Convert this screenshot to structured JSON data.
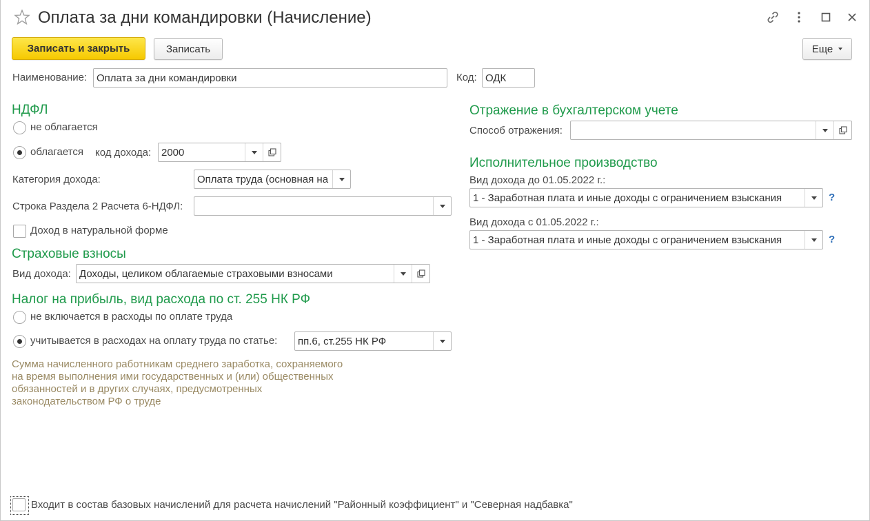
{
  "window": {
    "title": "Оплата за дни командировки (Начисление)"
  },
  "toolbar": {
    "save_close_label": "Записать и закрыть",
    "save_label": "Записать",
    "more_label": "Еще"
  },
  "header_fields": {
    "name_label": "Наименование:",
    "name_value": "Оплата за дни командировки",
    "code_label": "Код:",
    "code_value": "ОДК"
  },
  "ndfl": {
    "heading": "НДФЛ",
    "not_taxed_label": "не облагается",
    "taxed_label": "облагается",
    "taxed_selected": true,
    "income_code_label": "код дохода:",
    "income_code_value": "2000",
    "income_category_label": "Категория дохода:",
    "income_category_value": "Оплата труда (основная на",
    "section2_label": "Строка Раздела 2 Расчета 6-НДФЛ:",
    "section2_value": "",
    "in_kind_label": "Доход в натуральной форме",
    "in_kind_checked": false
  },
  "insurance": {
    "heading": "Страховые взносы",
    "income_type_label": "Вид дохода:",
    "income_type_value": "Доходы, целиком облагаемые страховыми взносами"
  },
  "profit_tax": {
    "heading": "Налог на прибыль, вид расхода по ст. 255 НК РФ",
    "not_included_label": "не включается в расходы по оплате труда",
    "included_label": "учитывается в расходах на оплату труда по статье:",
    "included_selected": true,
    "article_value": "пп.6, ст.255 НК РФ",
    "hint": "Сумма начисленного работникам среднего заработка, сохраняемого на время выполнения ими государственных и (или) общественных обязанностей и в других случаях, предусмотренных законодательством РФ о труде"
  },
  "accounting": {
    "heading": "Отражение в бухгалтерском учете",
    "method_label": "Способ отражения:",
    "method_value": ""
  },
  "enforcement": {
    "heading": "Исполнительное производство",
    "before_label": "Вид дохода до 01.05.2022 г.:",
    "before_value": "1 - Заработная плата и иные доходы с ограничением взыскания",
    "after_label": "Вид дохода с 01.05.2022 г.:",
    "after_value": "1 - Заработная плата и иные доходы с ограничением взыскания",
    "help_mark": "?"
  },
  "footer": {
    "base_accruals_label": "Входит в состав базовых начислений для расчета начислений \"Районный коэффициент\" и \"Северная надбавка\"",
    "base_accruals_checked": false
  },
  "colors": {
    "section_heading": "#1f9a4b",
    "primary_button": "#f6c900",
    "hint_text": "#9a8a64",
    "help_mark": "#2f6fb8"
  }
}
